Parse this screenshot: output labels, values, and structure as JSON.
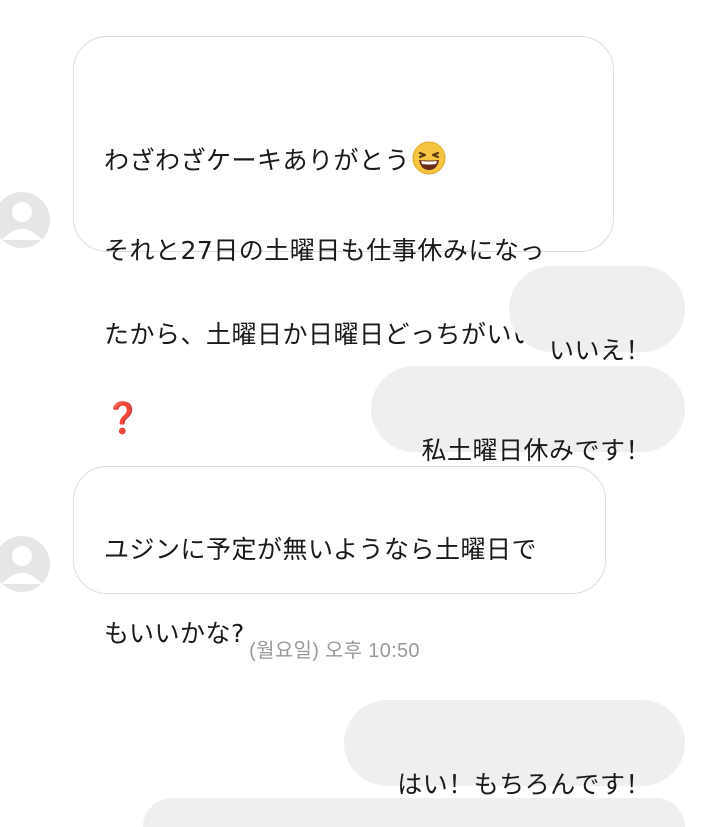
{
  "thread": {
    "messages": [
      {
        "sender": "them",
        "line1": "わざわざケーキありがとう",
        "emoji": "laughing-face-emoji",
        "line2": "それと27日の土曜日も仕事休みになっ",
        "line3": "たから、土曜日か日曜日どっちがいい",
        "trailing_symbol": "❓"
      },
      {
        "sender": "me",
        "text": "いいえ！"
      },
      {
        "sender": "me",
        "text": "私土曜日休みです！"
      },
      {
        "sender": "them",
        "line1": "ユジンに予定が無いようなら土曜日で",
        "line2": "もいいかな?"
      },
      {
        "sender": "me",
        "text": "はい！もちろんです！"
      }
    ],
    "timestamp": "(월요일) 오후 10:50"
  },
  "colors": {
    "incoming_bubble_bg": "#ffffff",
    "incoming_bubble_border": "#dcdcdc",
    "outgoing_bubble_bg": "#efefef",
    "timestamp_text": "#9a9a9a",
    "avatar_placeholder": "#c8c8c8"
  }
}
